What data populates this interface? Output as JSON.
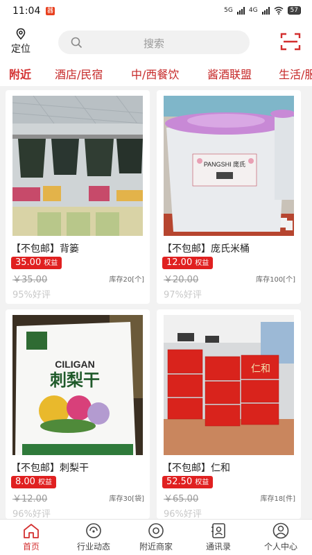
{
  "status_bar": {
    "time": "11:04",
    "notif_badge": "器",
    "net1": "5G",
    "net2": "4G",
    "battery": "57"
  },
  "header": {
    "location_label": "定位",
    "search_placeholder": "搜索"
  },
  "tabs": [
    "附近",
    "酒店/民宿",
    "中/西餐饮",
    "酱酒联盟",
    "生活/服务"
  ],
  "products": [
    {
      "name": "【不包邮】背篓",
      "price": "35.00",
      "price_tag": "权益",
      "original_price": "￥35.00",
      "stock": "库存20[个]",
      "rating": "95%好评"
    },
    {
      "name": "【不包邮】庞氏米桶",
      "price": "12.00",
      "price_tag": "权益",
      "original_price": "￥20.00",
      "stock": "库存100[个]",
      "rating": "97%好评"
    },
    {
      "name": "【不包邮】刺梨干",
      "price": "8.00",
      "price_tag": "权益",
      "original_price": "￥12.00",
      "stock": "库存30[袋]",
      "rating": "96%好评"
    },
    {
      "name": "【不包邮】仁和",
      "price": "52.50",
      "price_tag": "权益",
      "original_price": "￥65.00",
      "stock": "库存18[件]",
      "rating": "96%好评"
    }
  ],
  "image_text": {
    "rice_bucket_brand": "PANGSHI 庞氏",
    "snack_brand": "CILIGAN",
    "snack_title": "刺梨干",
    "wine_brand": "仁和"
  },
  "bottom_nav": [
    {
      "label": "首页",
      "icon": "home-icon"
    },
    {
      "label": "行业动态",
      "icon": "news-icon"
    },
    {
      "label": "附近商家",
      "icon": "nearby-icon"
    },
    {
      "label": "通讯录",
      "icon": "contacts-icon"
    },
    {
      "label": "个人中心",
      "icon": "user-icon"
    }
  ],
  "colors": {
    "accent": "#d32f2f",
    "price_bg": "#e02020",
    "page_bg": "#f2f2f2"
  }
}
